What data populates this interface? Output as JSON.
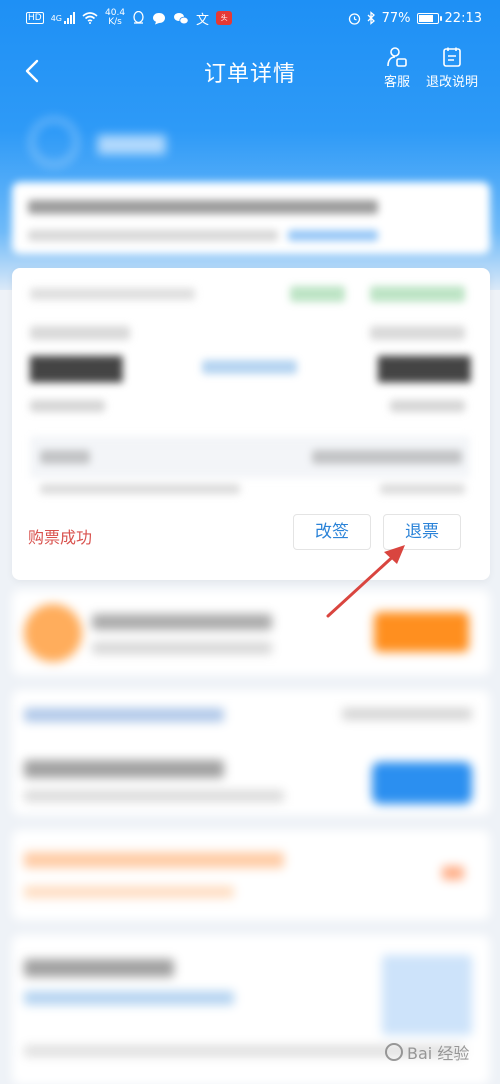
{
  "status_bar": {
    "hd": "HD",
    "network": "4G",
    "speed_value": "40.4",
    "speed_unit": "K/s",
    "battery": "77%",
    "battery_level": 0.77,
    "time": "22:13"
  },
  "nav": {
    "title": "订单详情",
    "customer_service": "客服",
    "refund_rules": "退改说明"
  },
  "ticket": {
    "purchase_status": "购票成功",
    "change_button": "改签",
    "refund_button": "退票"
  },
  "colors": {
    "brand_blue": "#1e90f5",
    "status_red": "#d9534f",
    "button_text": "#2b83d8",
    "arrow_red": "#d9453f"
  },
  "watermark": {
    "text": "Bai 经验"
  }
}
